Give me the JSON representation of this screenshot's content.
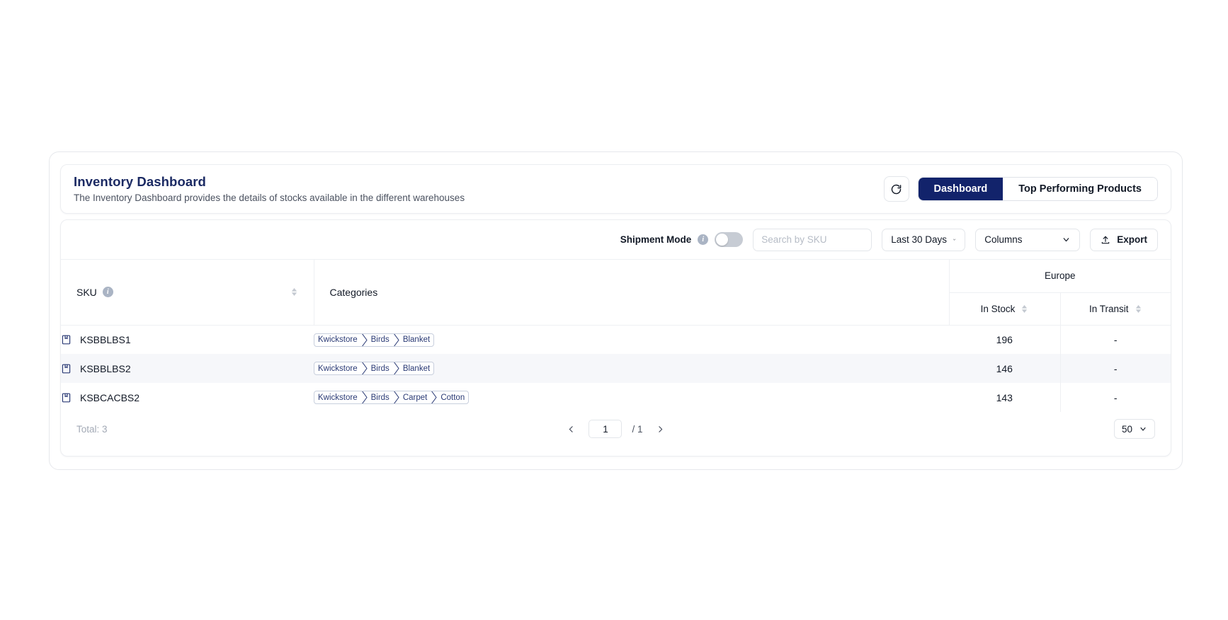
{
  "header": {
    "title": "Inventory Dashboard",
    "subtitle": "The Inventory Dashboard provides the details of stocks available in the different warehouses",
    "refresh_icon": "refresh-icon",
    "tabs": [
      {
        "label": "Dashboard",
        "active": true
      },
      {
        "label": "Top Performing Products",
        "active": false
      }
    ]
  },
  "toolbar": {
    "shipment_mode_label": "Shipment Mode",
    "shipment_mode_info_icon": "info-icon",
    "shipment_mode_on": false,
    "search_placeholder": "Search by SKU",
    "search_value": "",
    "date_range_label": "Last 30 Days",
    "columns_label": "Columns",
    "export_label": "Export",
    "export_icon": "upload-icon"
  },
  "table": {
    "columns": {
      "sku": "SKU",
      "sku_info_icon": "info-icon",
      "categories": "Categories",
      "group": "Europe",
      "in_stock": "In Stock",
      "in_transit": "In Transit"
    },
    "rows": [
      {
        "icon": "package-icon",
        "sku": "KSBBLBS1",
        "categories": [
          "Kwickstore",
          "Birds",
          "Blanket"
        ],
        "in_stock": "196",
        "in_transit": "-"
      },
      {
        "icon": "package-icon",
        "sku": "KSBBLBS2",
        "categories": [
          "Kwickstore",
          "Birds",
          "Blanket"
        ],
        "in_stock": "146",
        "in_transit": "-"
      },
      {
        "icon": "package-icon",
        "sku": "KSBCACBS2",
        "categories": [
          "Kwickstore",
          "Birds",
          "Carpet",
          "Cotton"
        ],
        "in_stock": "143",
        "in_transit": "-"
      }
    ]
  },
  "footer": {
    "total_label": "Total: 3",
    "prev_icon": "chevron-left-icon",
    "next_icon": "chevron-right-icon",
    "page_value": "1",
    "page_of": "/ 1",
    "page_size": "50"
  },
  "colors": {
    "brand_navy": "#12236b",
    "title_navy": "#1b2a63",
    "crumb_text": "#2a3a75",
    "muted": "#a2a9b5",
    "row_alt": "#f6f7fa"
  }
}
